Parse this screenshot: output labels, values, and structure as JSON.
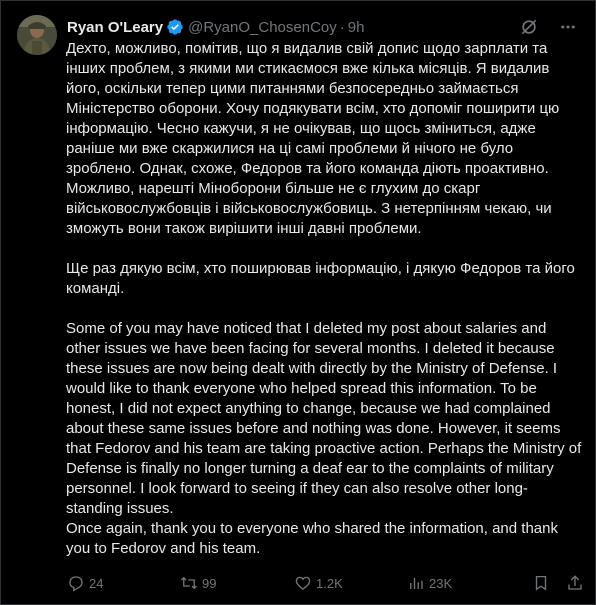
{
  "colors": {
    "background": "#000000",
    "text_primary": "#e7e9ea",
    "text_secondary": "#71767b",
    "verified_badge": "#1d9bf0",
    "border": "#2f3336"
  },
  "author": {
    "name": "Ryan O'Leary",
    "handle": "@RyanO_ChosenCoy",
    "separator": "·",
    "time": "9h",
    "verified_icon": "verified-badge-icon",
    "avatar": "avatar-photo"
  },
  "icons": {
    "grok": "grok-icon",
    "more": "more-icon",
    "reply": "reply-icon",
    "retweet": "retweet-icon",
    "like": "heart-icon",
    "views": "views-chart-icon",
    "bookmark": "bookmark-icon",
    "share": "share-icon"
  },
  "tweet": {
    "text": "Дехто, можливо, помітив, що я видалив свій допис щодо зарплати та інших проблем, з якими ми стикаємося вже кілька місяців. Я видалив його, оскільки тепер цими питаннями безпосередньо займається Міністерство оборони. Хочу подякувати всім, хто допоміг поширити цю інформацію. Чесно кажучи, я не очікував, що щось зміниться, адже раніше ми вже скаржилися на ці самі проблеми й нічого не було зроблено. Однак, схоже, Федоров та його команда діють проактивно. Можливо, нарешті Міноборони більше не є глухим до скарг військовослужбовців і військовослужбовиць. З нетерпінням чекаю, чи зможуть вони також вирішити інші давні проблеми.\n\nЩе раз дякую всім, хто поширював інформацію, і дякую Федоров та його команді.\n\nSome of you may have noticed that I deleted my post about salaries and other issues we have been facing for several months. I deleted it because these issues are now being dealt with directly by the Ministry of Defense. I would like to thank everyone who helped spread this information. To be honest, I did not expect anything to change, because we had complained about these same issues before and nothing was done. However, it seems that Fedorov and his team are taking proactive action. Perhaps the Ministry of Defense is finally no longer turning a deaf ear to the complaints of military personnel. I look forward to seeing if they can also resolve other long-standing issues.\nOnce again, thank you to everyone who shared the information, and thank you to Fedorov and his team."
  },
  "actions": {
    "replies": "24",
    "retweets": "99",
    "likes": "1.2K",
    "views": "23K"
  }
}
